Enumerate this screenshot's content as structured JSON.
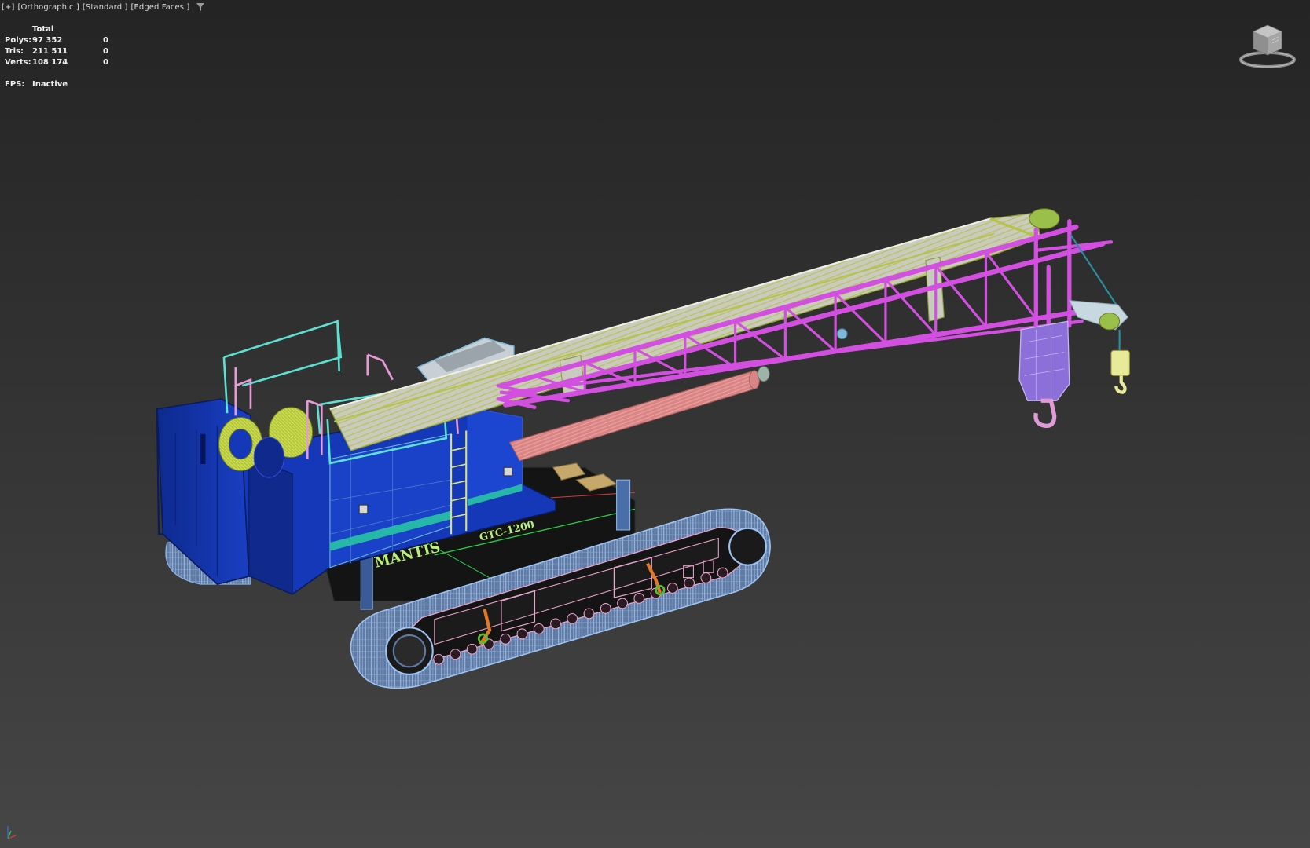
{
  "viewport": {
    "menus": [
      {
        "id": "plus",
        "label": "[+]"
      },
      {
        "id": "view",
        "label": "[Orthographic ]"
      },
      {
        "id": "shading",
        "label": "[Standard ]"
      },
      {
        "id": "edges",
        "label": "[Edged Faces ]"
      }
    ],
    "filter_icon": "filter-funnel-icon"
  },
  "stats": {
    "header": "Total",
    "rows": [
      {
        "label": "Polys:",
        "total": "97 352",
        "selected": "0"
      },
      {
        "label": "Tris:",
        "total": "211 511",
        "selected": "0"
      },
      {
        "label": "Verts:",
        "total": "108 174",
        "selected": "0"
      }
    ],
    "fps_label": "FPS:",
    "fps_value": "Inactive"
  },
  "navigation": {
    "viewcube_icon": "viewcube-icon",
    "axis_icon": "axis-tripod-icon"
  },
  "model": {
    "brand": "MANTIS",
    "model_code": "GTC-1200",
    "colors": {
      "body": "#1538b8",
      "jib": "#d24fe0",
      "boom": "#c9cbbe",
      "boom_wire": "#b7c24a",
      "track": "#8fb4e6",
      "cylinder": "#d97a7a",
      "railing_cyan": "#5ee0d0",
      "railing_pink": "#e89ad8",
      "drum": "#b6c83a"
    }
  }
}
